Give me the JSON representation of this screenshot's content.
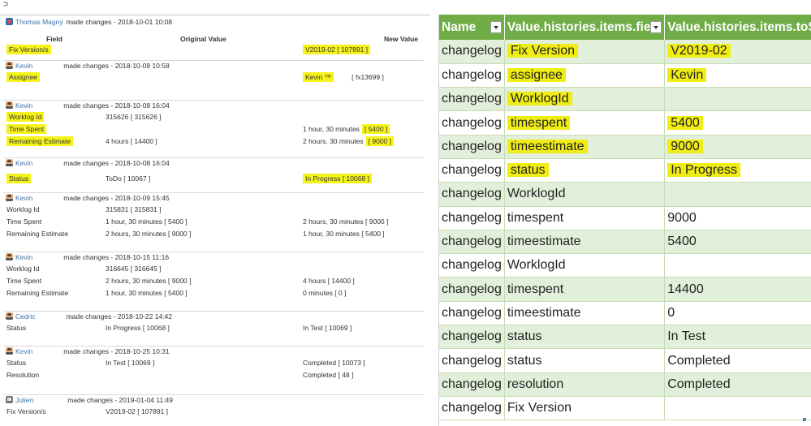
{
  "corner_mark": "⊃",
  "history": {
    "columns": {
      "field": "Field",
      "original": "Original Value",
      "new": "New Value"
    },
    "entries": [
      {
        "user": "Thomas Magny",
        "action": "made changes - 2018-10-01 10:08",
        "avatar": "team-avatar-icon",
        "rows": [
          {
            "field": "Fix Version/s",
            "orig": "",
            "new": "V2019-02 [ 107891 ]",
            "hl_field": true,
            "hl_new": true
          }
        ]
      },
      {
        "user": "Kevin",
        "action": "made changes - 2018-10-08 10:58",
        "avatar": "person-avatar-icon",
        "rows": [
          {
            "field": "Assignee",
            "orig": "",
            "new": "Kevin ™",
            "new2": "[ fx13699 ]",
            "hl_field": true,
            "hl_new": true
          }
        ]
      },
      {
        "user": "Kevin",
        "action": "made changes - 2018-10-08 16:04",
        "avatar": "person-avatar-icon",
        "rows": [
          {
            "field": "Worklog Id",
            "orig": "315626 [ 315626 ]",
            "new": "",
            "hl_field": true
          },
          {
            "field": "Time Spent",
            "orig": "",
            "new": "1 hour, 30 minutes",
            "new_hl_part": "[ 5400 ]",
            "hl_field": true
          },
          {
            "field": "Remaining Estimate",
            "orig": "4 hours [ 14400 ]",
            "new": "2 hours, 30 minutes",
            "new_hl_part": "[ 9000 ]",
            "hl_field": true
          }
        ]
      },
      {
        "user": "Kevin",
        "action": "made changes - 2018-10-08 16:04",
        "avatar": "person-avatar-icon",
        "rows": [
          {
            "field": "Status",
            "orig": "ToDo [ 10067 ]",
            "new": "In Progress [ 10068 ]",
            "hl_field": true,
            "hl_new": true
          }
        ]
      },
      {
        "user": "Kevin",
        "action": "made changes - 2018-10-09 15:45",
        "avatar": "person-avatar-icon",
        "rows": [
          {
            "field": "Worklog Id",
            "orig": "315831 [ 315831 ]",
            "new": ""
          },
          {
            "field": "Time Spent",
            "orig": "1 hour, 30 minutes [ 5400 ]",
            "new": "2 hours, 30 minutes [ 9000 ]"
          },
          {
            "field": "Remaining Estimate",
            "orig": "2 hours, 30 minutes [ 9000 ]",
            "new": "1 hour, 30 minutes [ 5400 ]"
          }
        ]
      },
      {
        "user": "Kevin",
        "action": "made changes - 2018-10-15 11:16",
        "avatar": "person-avatar-icon",
        "rows": [
          {
            "field": "Worklog Id",
            "orig": "316645 [ 316645 ]",
            "new": ""
          },
          {
            "field": "Time Spent",
            "orig": "2 hours, 30 minutes [ 9000 ]",
            "new": "4 hours [ 14400 ]"
          },
          {
            "field": "Remaining Estimate",
            "orig": "1 hour, 30 minutes [ 5400 ]",
            "new": "0 minutes [ 0 ]"
          }
        ]
      },
      {
        "user": "Cedric",
        "action": "made changes - 2018-10-22 14:42",
        "avatar": "person-avatar-icon",
        "rows": [
          {
            "field": "Status",
            "orig": "In Progress [ 10068 ]",
            "new": "In Test [ 10069 ]"
          }
        ]
      },
      {
        "user": "Kevin",
        "action": "made changes - 2018-10-25 10:31",
        "avatar": "person-avatar-icon",
        "rows": [
          {
            "field": "Status",
            "orig": "In Test [ 10069 ]",
            "new": "Completed [ 10073 ]"
          },
          {
            "field": "Resolution",
            "orig": "",
            "new": "Completed [ 48 ]"
          }
        ]
      },
      {
        "user": "Julien",
        "action": "made changes - 2019-01-04 11:49",
        "avatar": "julien-avatar-icon",
        "rows": [
          {
            "field": "Fix Version/s",
            "orig": "V2019-02 [ 107891 ]",
            "new": ""
          }
        ]
      }
    ]
  },
  "sheet": {
    "headers": [
      "Name",
      "Value.histories.items.field",
      "Value.histories.items.toString"
    ],
    "rows": [
      {
        "name": "changelog",
        "field": "Fix Version",
        "to": "V2019-02",
        "hl_field": true,
        "hl_to": true
      },
      {
        "name": "changelog",
        "field": "assignee",
        "to": "Kevin",
        "hl_field": true,
        "hl_to": true
      },
      {
        "name": "changelog",
        "field": "WorklogId",
        "to": "",
        "hl_field": true,
        "hl_to": false
      },
      {
        "name": "changelog",
        "field": "timespent",
        "to": "5400",
        "hl_field": true,
        "hl_to": true
      },
      {
        "name": "changelog",
        "field": "timeestimate",
        "to": "9000",
        "hl_field": true,
        "hl_to": true
      },
      {
        "name": "changelog",
        "field": "status",
        "to": "In Progress",
        "hl_field": true,
        "hl_to": true
      },
      {
        "name": "changelog",
        "field": "WorklogId",
        "to": ""
      },
      {
        "name": "changelog",
        "field": "timespent",
        "to": "9000"
      },
      {
        "name": "changelog",
        "field": "timeestimate",
        "to": "5400"
      },
      {
        "name": "changelog",
        "field": "WorklogId",
        "to": ""
      },
      {
        "name": "changelog",
        "field": "timespent",
        "to": "14400"
      },
      {
        "name": "changelog",
        "field": "timeestimate",
        "to": "0"
      },
      {
        "name": "changelog",
        "field": "status",
        "to": "In Test"
      },
      {
        "name": "changelog",
        "field": "status",
        "to": "Completed"
      },
      {
        "name": "changelog",
        "field": "resolution",
        "to": "Completed"
      },
      {
        "name": "changelog",
        "field": "Fix Version",
        "to": ""
      }
    ],
    "colors": {
      "header": "#70ad47",
      "band": "#e2efda",
      "highlight": "#f0ed14"
    }
  }
}
